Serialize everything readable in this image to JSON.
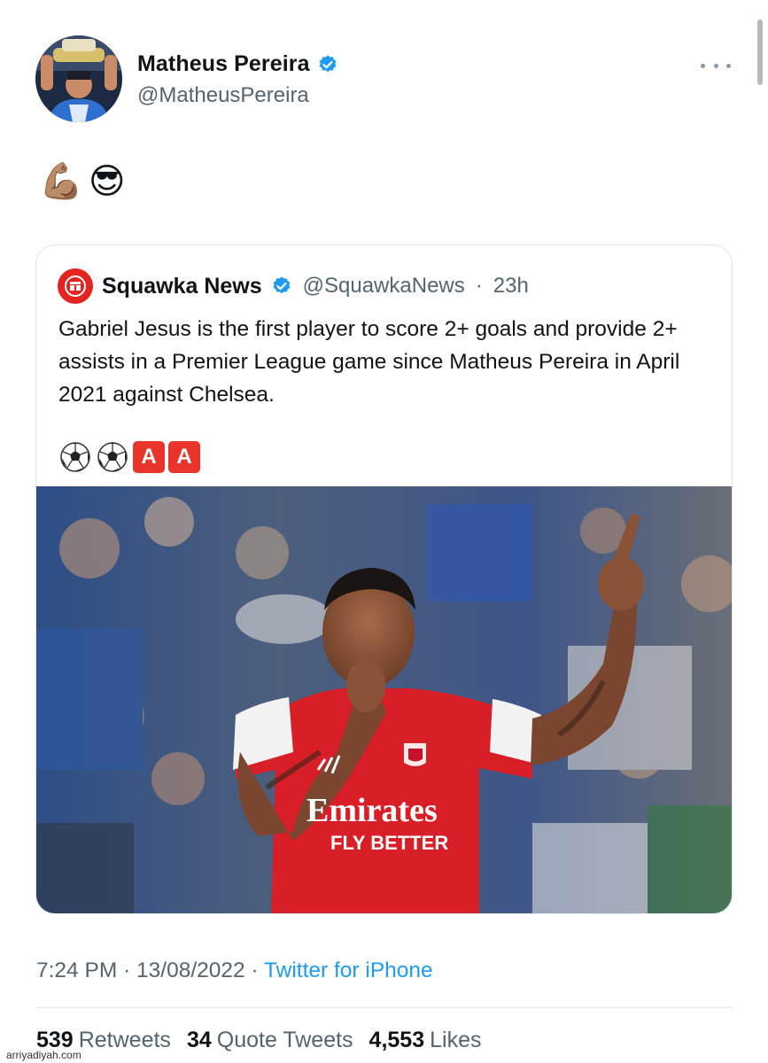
{
  "author": {
    "name": "Matheus Pereira",
    "handle": "@MatheusPereira"
  },
  "tweet": {
    "emoji": [
      "💪🏽",
      "😎"
    ]
  },
  "quoted": {
    "name": "Squawka News",
    "handle": "@SquawkaNews",
    "separator": "·",
    "time": "23h",
    "text": "Gabriel Jesus is the first player to score 2+ goals and provide 2+ assists in a Premier League game since Matheus Pereira in April 2021 against Chelsea.",
    "emoji_badges": [
      "⚽",
      "⚽",
      "A",
      "A"
    ],
    "photo_text": [
      "Emirates",
      "FLY BETTER"
    ]
  },
  "meta": {
    "time": "7:24 PM",
    "separator": "·",
    "date": "13/08/2022",
    "source": "Twitter for iPhone"
  },
  "stats": {
    "retweets_count": "539",
    "retweets_label": "Retweets",
    "quotes_count": "34",
    "quotes_label": "Quote Tweets",
    "likes_count": "4,553",
    "likes_label": "Likes"
  },
  "watermark": "arriyadiyah.com",
  "colors": {
    "verified": "#1d9bf0",
    "link": "#1d9bf0",
    "secondary_text": "#536471",
    "squawka_red": "#e52421"
  }
}
